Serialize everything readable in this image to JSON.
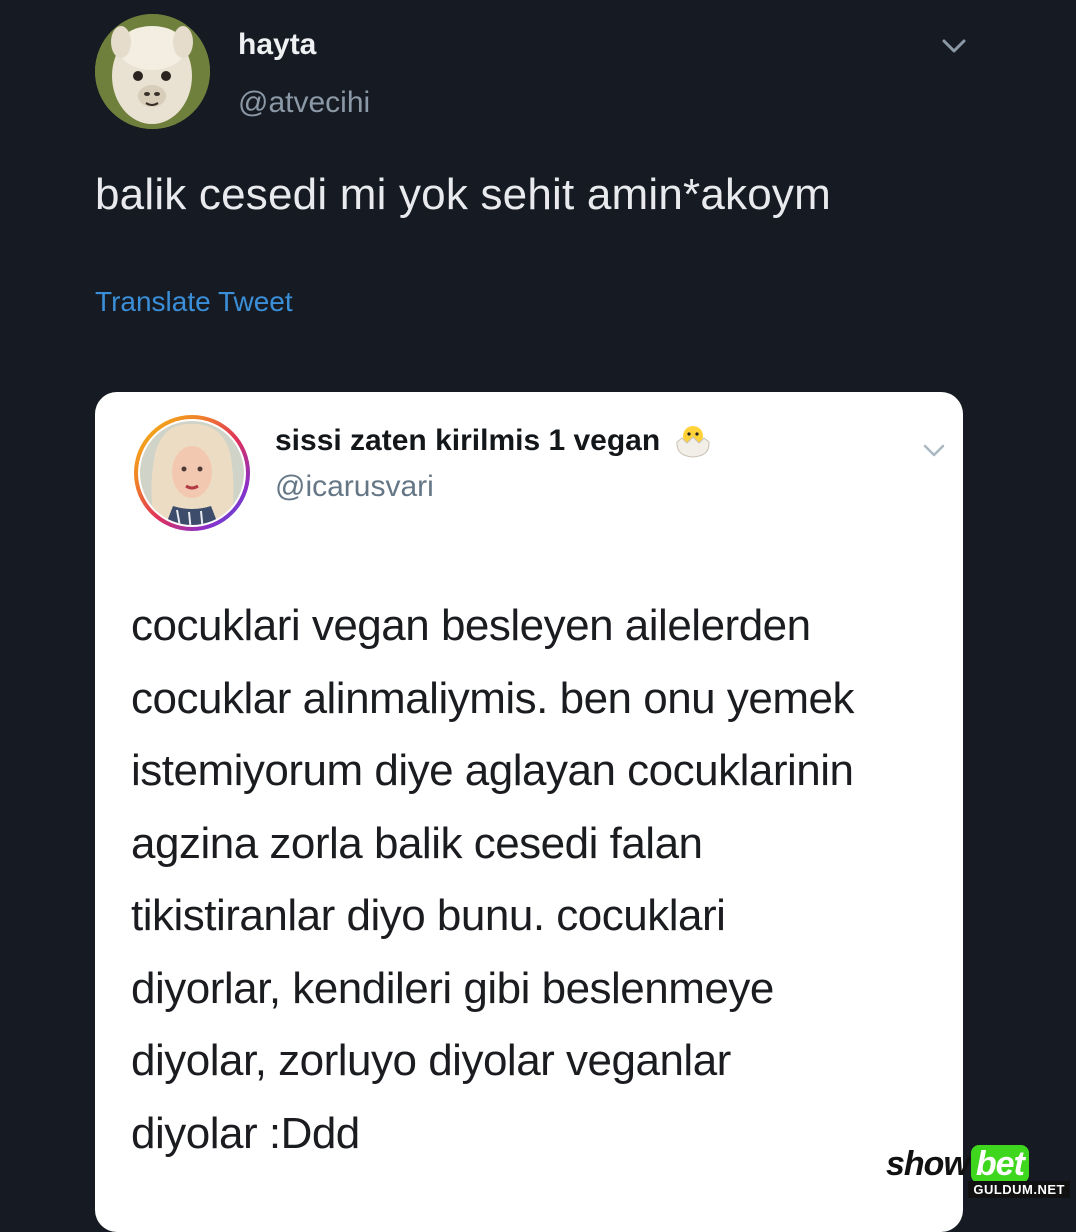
{
  "tweet": {
    "display_name": "hayta",
    "handle": "@atvecihi",
    "text": "balik cesedi mi yok sehit amin*akoym",
    "translate_label": "Translate Tweet",
    "avatar_icon": "alpaca-avatar",
    "menu_icon": "chevron-down-icon"
  },
  "quoted_tweet": {
    "display_name": "sissi zaten kirilmis 1 vegan",
    "emoji_icon": "hatching-chick-icon",
    "handle": "@icarusvari",
    "avatar_icon": "woman-avatar-rainbow-ring",
    "menu_icon": "chevron-down-icon",
    "text_lines": [
      "cocuklari vegan besleyen ailelerden",
      "cocuklar alinmaliymis. ben onu yemek",
      "istemiyorum diye aglayan cocuklarinin",
      "agzina zorla balik cesedi falan",
      "tikistiranlar diyo bunu. cocuklari",
      "diyorlar, kendileri gibi beslenmeye",
      "diyolar, zorluyo diyolar veganlar",
      "diyolar :Ddd"
    ]
  },
  "watermark": {
    "brand_show": "show",
    "brand_bet": "bet",
    "site": "GULDUM.NET"
  },
  "colors": {
    "background": "#161a23",
    "link": "#3a8fd8",
    "card": "#ffffff",
    "watermark_green": "#3fd61e"
  }
}
